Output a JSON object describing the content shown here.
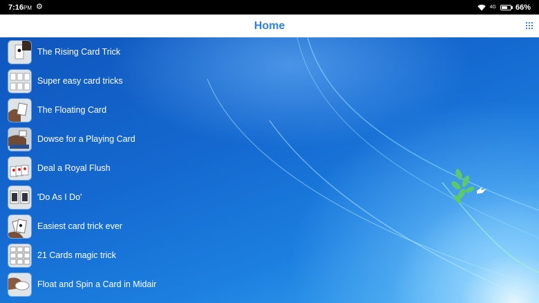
{
  "status": {
    "time": "7:16",
    "ampm": "PM",
    "network": "4G",
    "battery": "66%",
    "battery_level": 0.66
  },
  "app_bar": {
    "title": "Home",
    "menu_icon": "grid-icon"
  },
  "tricks": [
    {
      "label": "The Rising Card Trick",
      "icon": "rising-card-thumbnail"
    },
    {
      "label": "Super easy card tricks",
      "icon": "card-rows-thumbnail"
    },
    {
      "label": "The Floating Card",
      "icon": "floating-card-thumbnail"
    },
    {
      "label": "Dowse for a Playing Card",
      "icon": "dowse-card-thumbnail"
    },
    {
      "label": "Deal a Royal Flush",
      "icon": "royal-flush-thumbnail"
    },
    {
      "label": "'Do As I Do'",
      "icon": "two-decks-thumbnail"
    },
    {
      "label": "Easiest card trick ever",
      "icon": "card-fan-thumbnail"
    },
    {
      "label": "21 Cards magic trick",
      "icon": "card-grid-thumbnail"
    },
    {
      "label": "Float and Spin a Card in Midair",
      "icon": "spin-card-thumbnail"
    }
  ],
  "colors": {
    "accent": "#2f80de",
    "status_bar": "#000000",
    "app_bar": "#ffffff",
    "background": "#1560c4"
  }
}
